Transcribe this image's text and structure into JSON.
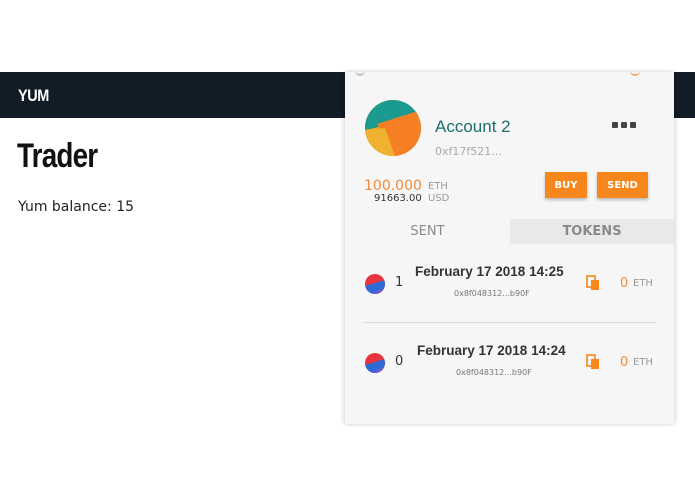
{
  "app": {
    "brand": "YUM"
  },
  "page": {
    "title": "Trader",
    "balance_text": "Yum balance: 15"
  },
  "wallet": {
    "account_name": "Account 2",
    "account_address": "0xf17f521...",
    "balance": {
      "eth_amount": "100.000",
      "eth_unit": "ETH",
      "usd_amount": "91663.00",
      "usd_unit": "USD"
    },
    "buttons": {
      "buy": "BUY",
      "send": "SEND"
    },
    "tabs": [
      {
        "label": "SENT",
        "active": true
      },
      {
        "label": "TOKENS",
        "active": false
      }
    ],
    "transactions": [
      {
        "nonce": "1",
        "date": "February 17 2018 14:25",
        "hash": "0x8f048312...b90F",
        "value": "0",
        "unit": "ETH"
      },
      {
        "nonce": "0",
        "date": "February 17 2018 14:24",
        "hash": "0x8f048312...b90F",
        "value": "0",
        "unit": "ETH"
      }
    ],
    "colors": {
      "accent": "#f7861c",
      "account_name": "#1d6f6a",
      "header_bg": "#121c27"
    }
  }
}
